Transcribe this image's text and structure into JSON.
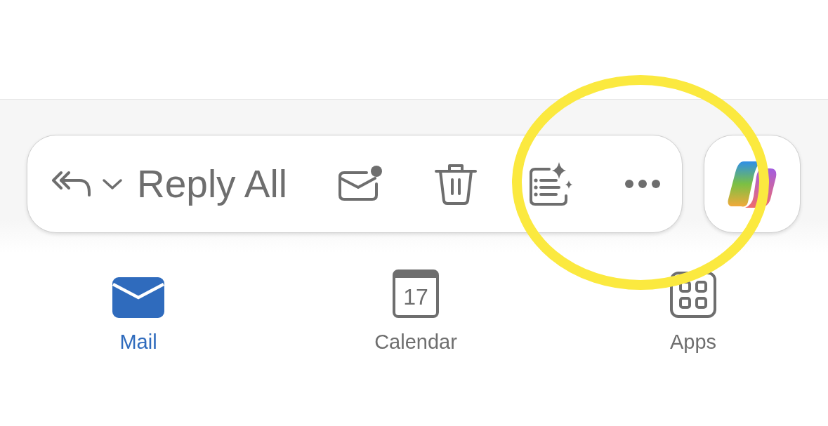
{
  "toolbar": {
    "reply_label": "Reply All",
    "actions": [
      {
        "kind": "unread"
      },
      {
        "kind": "delete"
      },
      {
        "kind": "summarize"
      },
      {
        "kind": "more"
      }
    ]
  },
  "tabs": [
    {
      "kind": "mail",
      "label": "Mail",
      "selected": true
    },
    {
      "kind": "calendar",
      "label": "Calendar",
      "day": "17",
      "selected": false
    },
    {
      "kind": "apps",
      "label": "Apps",
      "selected": false
    }
  ]
}
